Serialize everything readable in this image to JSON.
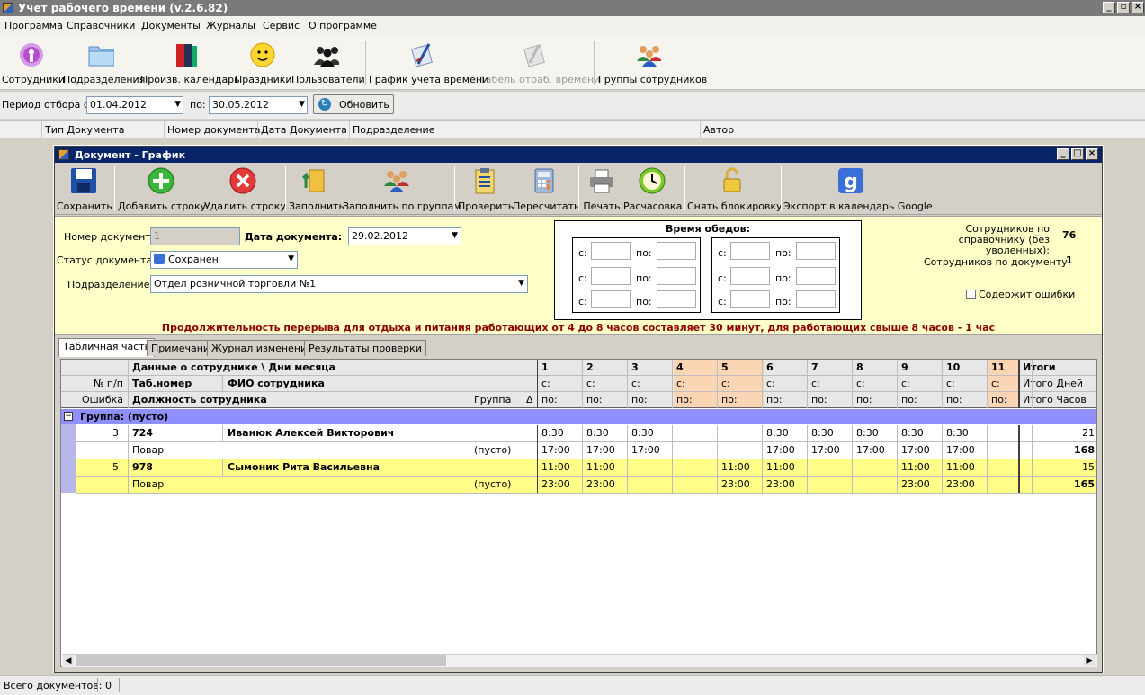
{
  "app": {
    "title": "Учет рабочего времени (v.2.6.82)"
  },
  "menu": [
    "Программа",
    "Справочники",
    "Документы",
    "Журналы",
    "Сервис",
    "О программе"
  ],
  "toolbar": [
    {
      "label": "Сотрудники",
      "icon": "employee-icon"
    },
    {
      "label": "Подразделения",
      "icon": "folder-icon"
    },
    {
      "label": "Произв. календарь",
      "icon": "calendar-book-icon"
    },
    {
      "label": "Праздники",
      "icon": "smiley-icon"
    },
    {
      "label": "Пользователи",
      "icon": "users-icon"
    },
    {
      "label": "График учета времени",
      "icon": "schedule-icon"
    },
    {
      "label": "Табель отраб. времени",
      "icon": "timesheet-icon",
      "disabled": true
    },
    {
      "label": "Группы сотрудников",
      "icon": "groups-icon"
    }
  ],
  "filter": {
    "period_label": "Период отбора с:",
    "from": "01.04.2012",
    "to_label": "по:",
    "to": "30.05.2012",
    "refresh": "Обновить"
  },
  "list_columns": [
    "Тип Документа",
    "Номер документа",
    "Дата Документа",
    "Подразделение",
    "Автор"
  ],
  "doc": {
    "title": "Документ - График",
    "toolbar": [
      "Сохранить",
      "Добавить строку",
      "Удалить строку",
      "Заполнить",
      "Заполнить по группам",
      "Проверить",
      "Пересчитать",
      "Печать",
      "Расчасовка",
      "Снять блокировку",
      "Экспорт в календарь Google"
    ],
    "number_label": "Номер документа:",
    "number": "1",
    "date_label": "Дата документа:",
    "date": "29.02.2012",
    "status_label": "Статус документа:",
    "status": "Сохранен",
    "dept_label": "Подразделение:",
    "dept": "Отдел розничной торговли №1",
    "lunch_title": "Время обедов:",
    "lunch_from": "с:",
    "lunch_to": "по:",
    "emp_ref_label": "Сотрудников по справочнику (без уволенных):",
    "emp_ref": "76",
    "emp_doc_label": "Сотрудников по документу:",
    "emp_doc": "1",
    "errors_label": "Содержит ошибки",
    "notice": "Продолжительность перерыва для отдыха и питания работающих от 4 до 8 часов  составляет 30 минут, для работающих свыше 8 часов - 1 час",
    "tabs": [
      "Табличная часть",
      "Примечания",
      "Журнал изменений",
      "Результаты проверки"
    ]
  },
  "grid": {
    "h_data": "Данные о сотруднике \\ Дни месяца",
    "h_no": "№ п/п",
    "h_tab": "Таб.номер",
    "h_fio": "ФИО сотрудника",
    "h_err": "Ошибка",
    "h_pos": "Должность сотрудника",
    "h_group": "Группа",
    "h_tot": "Итоги",
    "h_days": "Итого Дней",
    "h_hours": "Итого Часов",
    "days": [
      "1",
      "2",
      "3",
      "4",
      "5",
      "6",
      "7",
      "8",
      "9",
      "10",
      "11"
    ],
    "weekend": [
      3,
      4,
      10
    ],
    "s": "с:",
    "p": "по:",
    "group_row": "Группа: (пусто)",
    "rows": [
      {
        "no": "3",
        "tab": "724",
        "fio": "Иванюк Алексей Викторович",
        "pos": "Повар",
        "group": "(пусто)",
        "s": [
          "8:30",
          "8:30",
          "8:30",
          "",
          "",
          "8:30",
          "8:30",
          "8:30",
          "8:30",
          "8:30",
          ""
        ],
        "e": [
          "17:00",
          "17:00",
          "17:00",
          "",
          "",
          "17:00",
          "17:00",
          "17:00",
          "17:00",
          "17:00",
          ""
        ],
        "days": "21",
        "hours": "168",
        "hl": false
      },
      {
        "no": "5",
        "tab": "978",
        "fio": "Сымоник Рита Васильевна",
        "pos": "Повар",
        "group": "(пусто)",
        "s": [
          "11:00",
          "11:00",
          "",
          "",
          "11:00",
          "11:00",
          "",
          "",
          "11:00",
          "11:00",
          ""
        ],
        "e": [
          "23:00",
          "23:00",
          "",
          "",
          "23:00",
          "23:00",
          "",
          "",
          "23:00",
          "23:00",
          ""
        ],
        "days": "15",
        "hours": "165",
        "hl": true
      }
    ]
  },
  "status": {
    "label": "Всего документов:",
    "count": "0"
  }
}
